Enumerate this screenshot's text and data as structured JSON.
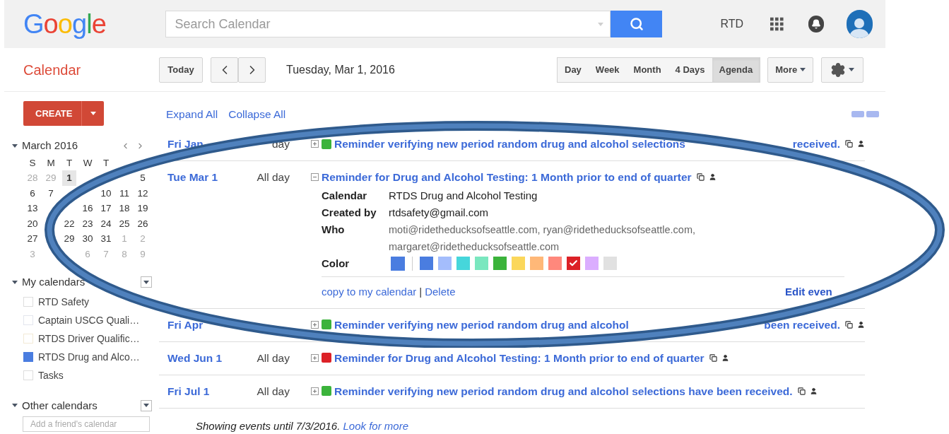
{
  "header": {
    "logo": "Google",
    "search": {
      "placeholder": "Search Calendar"
    },
    "user": "RTD"
  },
  "toolbar": {
    "app_title": "Calendar",
    "today": "Today",
    "date": "Tuesday, Mar 1, 2016",
    "views": [
      {
        "label": "Day",
        "selected": false
      },
      {
        "label": "Week",
        "selected": false
      },
      {
        "label": "Month",
        "selected": false
      },
      {
        "label": "4 Days",
        "selected": false
      },
      {
        "label": "Agenda",
        "selected": true
      }
    ],
    "more": "More"
  },
  "sidebar": {
    "create": "CREATE",
    "mini_calendar": {
      "title": "March 2016",
      "weekdays": [
        "S",
        "M",
        "T",
        "W",
        "T"
      ],
      "weeks": [
        [
          {
            "kind": "day",
            "day": "28",
            "muted": true,
            "today": false
          },
          {
            "kind": "day",
            "day": "29",
            "muted": true,
            "today": false
          },
          {
            "kind": "day",
            "day": "1",
            "muted": false,
            "today": true
          },
          {
            "kind": "covered"
          },
          {
            "kind": "covered"
          },
          {
            "kind": "covered"
          },
          {
            "kind": "day",
            "day": "5",
            "muted": false,
            "today": false
          }
        ],
        [
          {
            "kind": "day",
            "day": "6",
            "muted": false,
            "today": false
          },
          {
            "kind": "day",
            "day": "7",
            "muted": false,
            "today": false
          },
          {
            "kind": "covered"
          },
          {
            "kind": "covered"
          },
          {
            "kind": "day",
            "day": "10",
            "muted": false,
            "today": false
          },
          {
            "kind": "day",
            "day": "11",
            "muted": false,
            "today": false
          },
          {
            "kind": "day",
            "day": "12",
            "muted": false,
            "today": false
          }
        ],
        [
          {
            "kind": "day",
            "day": "13",
            "muted": false,
            "today": false
          },
          {
            "kind": "covered"
          },
          {
            "kind": "covered"
          },
          {
            "kind": "day",
            "day": "16",
            "muted": false,
            "today": false
          },
          {
            "kind": "day",
            "day": "17",
            "muted": false,
            "today": false
          },
          {
            "kind": "day",
            "day": "18",
            "muted": false,
            "today": false
          },
          {
            "kind": "day",
            "day": "19",
            "muted": false,
            "today": false
          }
        ],
        [
          {
            "kind": "day",
            "day": "20",
            "muted": false,
            "today": false
          },
          {
            "kind": "covered"
          },
          {
            "kind": "day",
            "day": "22",
            "muted": false,
            "today": false
          },
          {
            "kind": "day",
            "day": "23",
            "muted": false,
            "today": false
          },
          {
            "kind": "day",
            "day": "24",
            "muted": false,
            "today": false
          },
          {
            "kind": "day",
            "day": "25",
            "muted": false,
            "today": false
          },
          {
            "kind": "day",
            "day": "26",
            "muted": false,
            "today": false
          }
        ],
        [
          {
            "kind": "day",
            "day": "27",
            "muted": false,
            "today": false
          },
          {
            "kind": "covered"
          },
          {
            "kind": "day",
            "day": "29",
            "muted": false,
            "today": false
          },
          {
            "kind": "day",
            "day": "30",
            "muted": false,
            "today": false
          },
          {
            "kind": "day",
            "day": "31",
            "muted": false,
            "today": false
          },
          {
            "kind": "day",
            "day": "1",
            "muted": true,
            "today": false
          },
          {
            "kind": "day",
            "day": "2",
            "muted": true,
            "today": false
          }
        ],
        [
          {
            "kind": "day",
            "day": "3",
            "muted": true,
            "today": false
          },
          {
            "kind": "covered"
          },
          {
            "kind": "covered"
          },
          {
            "kind": "day",
            "day": "6",
            "muted": true,
            "today": false
          },
          {
            "kind": "day",
            "day": "7",
            "muted": true,
            "today": false
          },
          {
            "kind": "day",
            "day": "8",
            "muted": true,
            "today": false
          },
          {
            "kind": "day",
            "day": "9",
            "muted": true,
            "today": false
          }
        ]
      ]
    },
    "my_calendars": {
      "title": "My calendars",
      "items": [
        {
          "label": "RTD Safety",
          "checked": false,
          "color": "#dddddd"
        },
        {
          "label": "Captain USCG Quali…",
          "checked": false,
          "color": "#e3e6ee"
        },
        {
          "label": "RTDS Driver Qualific…",
          "checked": false,
          "color": "#f2ead6"
        },
        {
          "label": "RTDS Drug and Alco…",
          "checked": true,
          "color": "#4a7de0"
        },
        {
          "label": "Tasks",
          "checked": false,
          "color": "#dddddd"
        }
      ]
    },
    "other_calendars": {
      "title": "Other calendars",
      "placeholder": "Add a friend's calendar"
    }
  },
  "main": {
    "expand_all": "Expand All",
    "collapse_all": "Collapse All",
    "events": [
      {
        "date": "Fri Jan",
        "time": "day",
        "title_parts": [
          "Reminder verifying new period random drug and alcohol selections",
          "received."
        ],
        "color": "#3bb33b",
        "expanded": false
      },
      {
        "date": "Tue Mar 1",
        "time": "All day",
        "title_parts": [
          "Reminder for Drug and Alcohol Testing: 1 Month prior to end of quarter"
        ],
        "expanded": true,
        "details": {
          "fields": [
            {
              "label": "Calendar",
              "value": "RTDS Drug and Alcohol Testing",
              "kind": "plain"
            },
            {
              "label": "Created by",
              "value": "rtdsafety@gmail.com",
              "kind": "plain"
            },
            {
              "label": "Who",
              "value": "moti@ridetheducksofseattle.com, ryan@ridetheducksofseattle.com, margaret@ridetheducksofseattle.com",
              "kind": "guests"
            }
          ],
          "color_label": "Color",
          "current_swatch": {
            "color": "#4a7de0"
          },
          "swatches": [
            {
              "color": "#4a7de0",
              "selected": false
            },
            {
              "color": "#a4bdfc",
              "selected": false
            },
            {
              "color": "#46d6db",
              "selected": false
            },
            {
              "color": "#7ae7bf",
              "selected": false
            },
            {
              "color": "#3bb33b",
              "selected": false
            },
            {
              "color": "#fbd75b",
              "selected": false
            },
            {
              "color": "#ffb878",
              "selected": false
            },
            {
              "color": "#ff887c",
              "selected": false
            },
            {
              "color": "#dc2127",
              "selected": true
            },
            {
              "color": "#dbadff",
              "selected": false
            },
            {
              "color": "#e1e1e1",
              "selected": false
            }
          ],
          "copy": "copy to my calendar",
          "separator": "|",
          "delete": "Delete",
          "edit": "Edit even"
        }
      },
      {
        "date": "Fri Apr",
        "title_parts": [
          "Reminder verifying new period random drug and alcohol",
          "been received."
        ],
        "color": "#3bb33b",
        "expanded": false
      },
      {
        "date": "Wed Jun 1",
        "time": "All day",
        "title_parts": [
          "Reminder for Drug and Alcohol Testing: 1 Month prior to end of quarter"
        ],
        "color": "#dc2127",
        "expanded": false
      },
      {
        "date": "Fri Jul 1",
        "time": "All day",
        "title_parts": [
          "Reminder verifying new period random drug and alcohol selections have been received."
        ],
        "color": "#3bb33b",
        "expanded": false
      }
    ],
    "footer": {
      "text": "Showing events until 7/3/2016.",
      "link": "Look for more"
    }
  }
}
